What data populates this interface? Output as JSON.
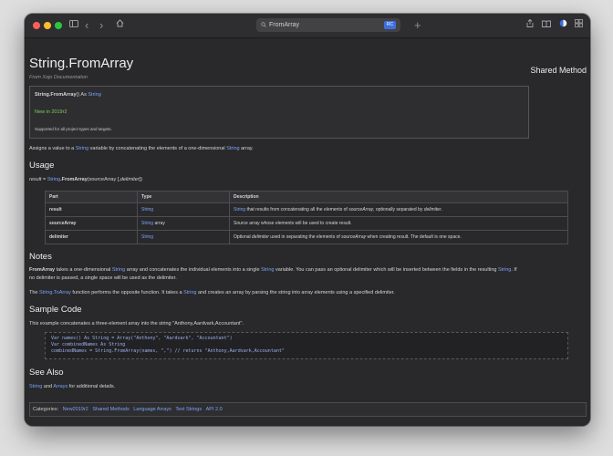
{
  "browser": {
    "url_text": "FromArray",
    "reader_badge": "RC",
    "back_glyph": "‹",
    "forward_glyph": "›",
    "new_tab_glyph": "+"
  },
  "page": {
    "title": "String.FromArray",
    "method_type": "Shared Method",
    "from_line": "From Xojo Documentation"
  },
  "infobox": {
    "signature_bold": "String.FromArray",
    "signature_mid": "() As ",
    "signature_type": "String",
    "new_in": "New in 2019r2",
    "supported": "Supported for all project types and targets."
  },
  "summary": {
    "p1": "Assigns a value to a ",
    "link1": "String",
    "p2": " variable by concatenating the elements of a one-dimensional ",
    "link2": "String",
    "p3": " array."
  },
  "usage": {
    "heading": "Usage",
    "result_word": "result",
    "eq": " = ",
    "link": "String",
    "method": ".FromArray",
    "args_open": "(sourceArray [,",
    "args_italic": "delimiter",
    "args_close": "])"
  },
  "table": {
    "headers": [
      "Part",
      "Type",
      "Description"
    ],
    "rows": [
      {
        "part": "result",
        "type": "String",
        "type_suffix": "",
        "desc_link": "String",
        "desc_a": " that results from concatenating all the elements of ",
        "desc_i1": "sourceArray",
        "desc_b": ", optionally separated by ",
        "desc_i2": "delimiter",
        "desc_c": "."
      },
      {
        "part": "sourceArray",
        "type": "String",
        "type_suffix": " array",
        "desc_link": "",
        "desc_a": "Source array whose elements will be used to create result.",
        "desc_i1": "",
        "desc_b": "",
        "desc_i2": "",
        "desc_c": ""
      },
      {
        "part": "delimiter",
        "type": "String",
        "type_suffix": "",
        "desc_link": "",
        "desc_a": "Optional ",
        "desc_i1": "delimiter",
        "desc_b": " used in separating the elements of ",
        "desc_i2": "sourceArray",
        "desc_c": " when creating result. The default is one space."
      }
    ]
  },
  "notes": {
    "heading": "Notes",
    "n1_bold": "FromArray",
    "n1_a": " takes a one-dimensional ",
    "n1_link1": "String",
    "n1_b": " array and concatenates the individual elements into a single ",
    "n1_link2": "String",
    "n1_c": " variable. You can pass an optional delimiter which will be inserted between the fields in the resulting ",
    "n1_link3": "String",
    "n1_d": ". If",
    "n1_line2": "no delimiter is passed, a single space will be used as the delimiter.",
    "n2_a": "The ",
    "n2_link1": "String.ToArray",
    "n2_b": " function performs the opposite function. It takes a ",
    "n2_link2": "String",
    "n2_c": " and creates an array by parsing the string into array elements using a specified delimiter."
  },
  "sample": {
    "heading": "Sample Code",
    "intro": "This example concatenates a three-element array into the string \"Anthony,Aardvark,Accountant\".",
    "code": [
      "Var names() As String = Array(\"Anthony\", \"Aardvark\", \"Accountant\")",
      "Var combinedNames As String",
      "combinedNames = String.FromArray(names, \",\") // returns \"Anthony,Aardvark,Accountant\""
    ]
  },
  "see_also": {
    "heading": "See Also",
    "link1": "String",
    "and": " and ",
    "link2": "Arrays",
    "tail": " for additional details."
  },
  "categories": {
    "label": "Categories:",
    "items": [
      "New2019r2",
      "Shared Methods",
      "Language Arrays",
      "Text Strings",
      "API 2.0"
    ]
  },
  "colors": {
    "link": "#7aa2f7",
    "new_in": "#7fcf5f",
    "background": "#29292b",
    "accent": "#3d6fe0"
  }
}
